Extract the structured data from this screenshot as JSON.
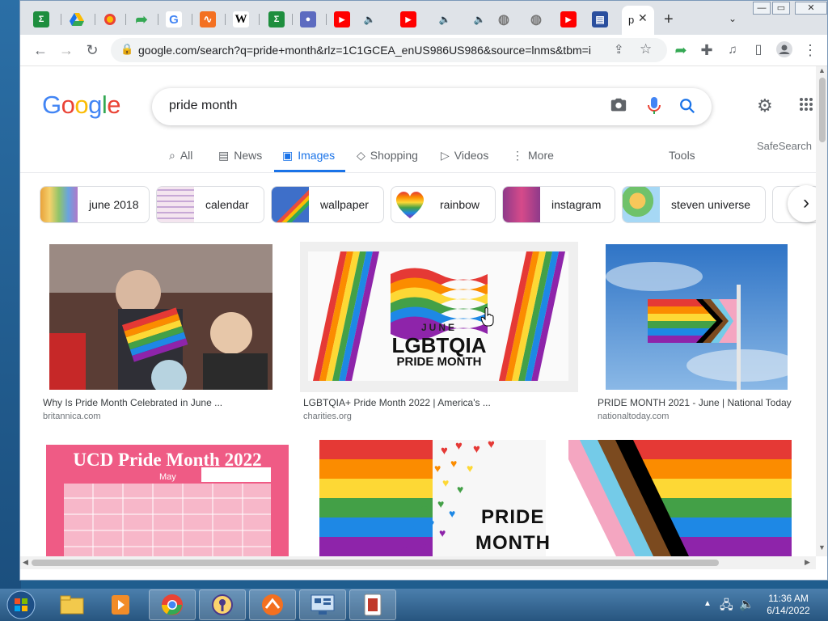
{
  "browser": {
    "url": "google.com/search?q=pride+month&rlz=1C1GCEA_enUS986US986&source=lnms&tbm=is...",
    "active_tab_title": "p"
  },
  "google": {
    "logo_text": "Google",
    "query": "pride month",
    "tabs": [
      {
        "label": "All",
        "icon": "search-icon"
      },
      {
        "label": "News",
        "icon": "news-icon"
      },
      {
        "label": "Images",
        "icon": "image-icon"
      },
      {
        "label": "Shopping",
        "icon": "tag-icon"
      },
      {
        "label": "Videos",
        "icon": "play-icon"
      },
      {
        "label": "More",
        "icon": "more-vert-icon"
      }
    ],
    "tools_label": "Tools",
    "safesearch_label": "SafeSearch",
    "chips": [
      {
        "label": "june 2018",
        "color": "#e8a33c"
      },
      {
        "label": "calendar",
        "color": "#c7a8d6"
      },
      {
        "label": "wallpaper",
        "color": "#3e6fc9"
      },
      {
        "label": "rainbow",
        "color": "#e84c3d"
      },
      {
        "label": "instagram",
        "color": "#8e3a8a"
      },
      {
        "label": "steven universe",
        "color": "#6fc26b"
      }
    ],
    "results": [
      {
        "caption": "Why Is Pride Month Celebrated in June ...",
        "source": "britannica.com"
      },
      {
        "caption": "LGBTQIA+ Pride Month 2022 | America's ...",
        "source": "charities.org",
        "image_text": [
          "JUNE",
          "LGBTQIA",
          "PRIDE MONTH"
        ]
      },
      {
        "caption": "PRIDE MONTH 2021 - June | National Today",
        "source": "nationaltoday.com"
      },
      {
        "image_text": [
          "UCD Pride Month 2022",
          "May"
        ]
      },
      {
        "image_text": [
          "PRIDE",
          "MONTH"
        ]
      },
      {}
    ]
  },
  "taskbar": {
    "time": "11:36 AM",
    "date": "6/14/2022"
  }
}
